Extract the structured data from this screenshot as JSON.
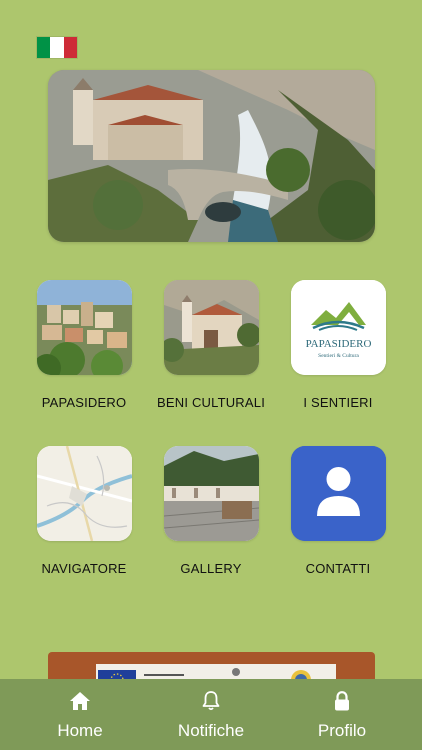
{
  "flag": {
    "icon": "italian-flag-icon",
    "colors": [
      "#009246",
      "#ffffff",
      "#ce2b37"
    ]
  },
  "grid": [
    {
      "label": "PAPASIDERO"
    },
    {
      "label": "BENI CULTURALI"
    },
    {
      "label": "I SENTIERI"
    },
    {
      "label": "NAVIGATORE"
    },
    {
      "label": "GALLERY"
    },
    {
      "label": "CONTATTI"
    }
  ],
  "sentieri_logo": {
    "title": "PAPASIDERO",
    "subtitle": "Sentieri & Cultura"
  },
  "tabs": [
    {
      "label": "Home",
      "icon": "home-icon"
    },
    {
      "label": "Notifiche",
      "icon": "bell-icon"
    },
    {
      "label": "Profilo",
      "icon": "lock-icon"
    }
  ],
  "colors": {
    "background": "#adc66d",
    "tabbar": "#7f9a58",
    "contact_tile": "#3a63c9",
    "banner": "#a8562a"
  }
}
